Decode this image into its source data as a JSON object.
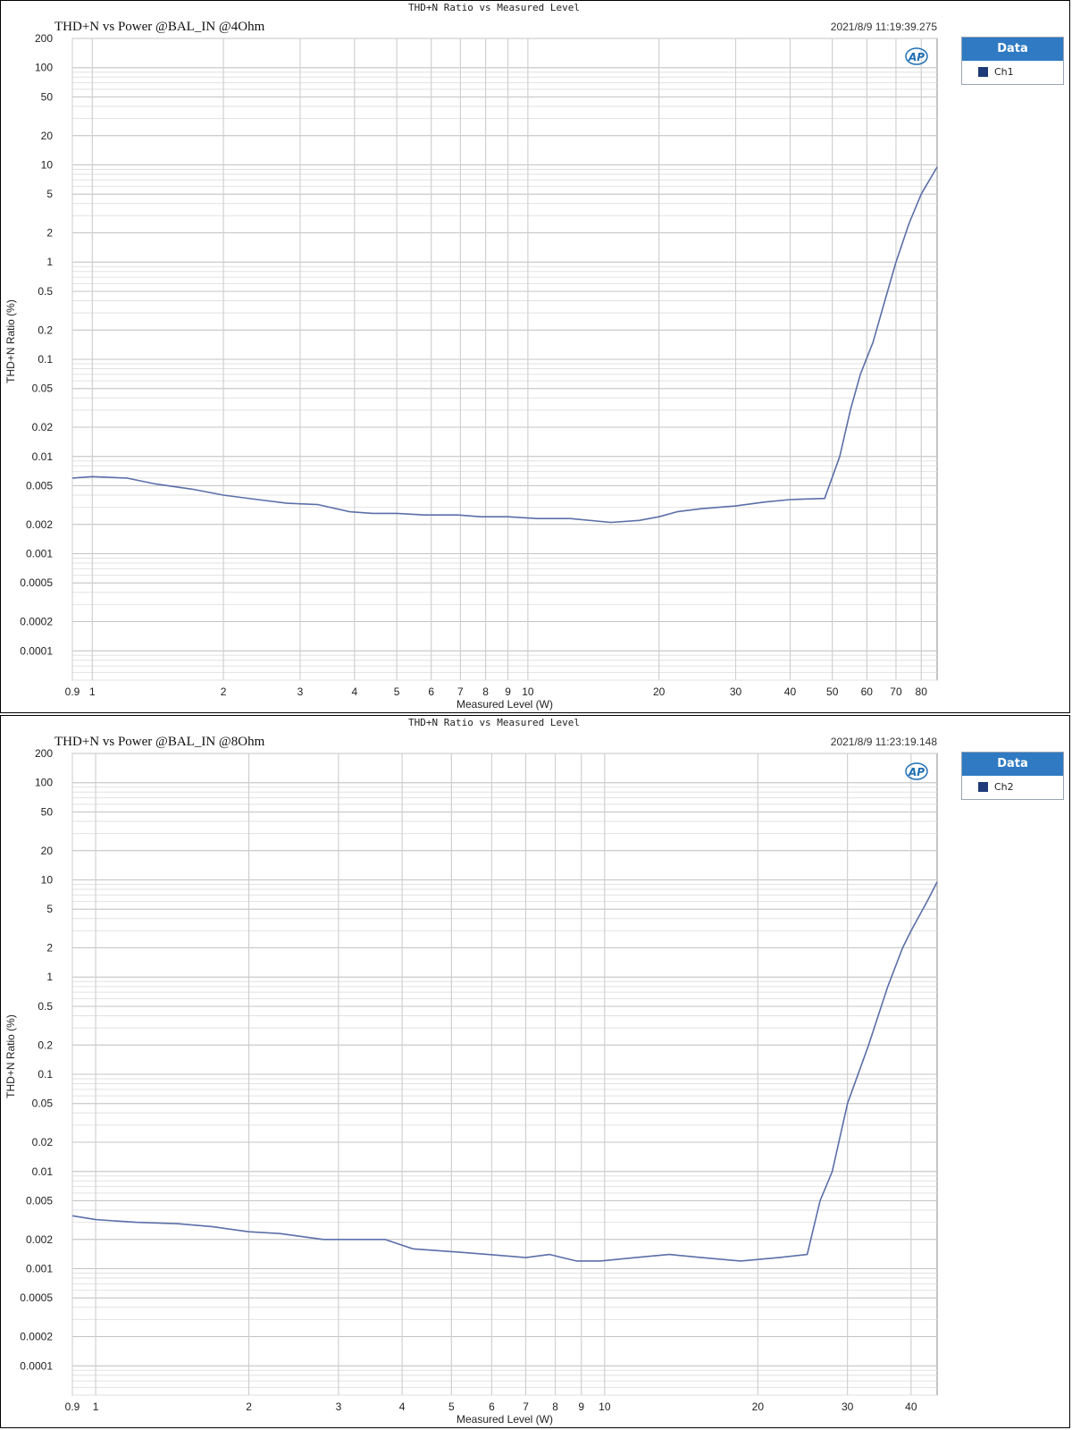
{
  "colors": {
    "line": "#5b6fa8",
    "legend_header": "#2f7ac2",
    "swatch": "#1f3a78",
    "logo": "#1f6fb5"
  },
  "chart_data": [
    {
      "type": "line",
      "suptitle": "THD+N Ratio vs Measured Level",
      "title": "THD+N vs Power @BAL_IN @4Ohm",
      "timestamp": "2021/8/9 11:19:39.275",
      "xlabel": "Measured Level (W)",
      "ylabel": "THD+N Ratio (%)",
      "xscale": "log",
      "yscale": "log",
      "xlim": [
        0.9,
        87
      ],
      "ylim": [
        5e-05,
        200
      ],
      "grid": true,
      "legend_position": "right",
      "legend_title": "Data",
      "x_ticks": [
        0.9,
        1,
        2,
        3,
        4,
        5,
        6,
        7,
        8,
        9,
        10,
        20,
        30,
        40,
        50,
        60,
        70,
        80
      ],
      "x_tick_labels": [
        "0.9",
        "1",
        "2",
        "3",
        "4",
        "5",
        "6",
        "7",
        "8",
        "9",
        "10",
        "20",
        "30",
        "40",
        "50",
        "60",
        "70",
        "80"
      ],
      "y_ticks": [
        200,
        100,
        50,
        20,
        10,
        5,
        2,
        1,
        0.5,
        0.2,
        0.1,
        0.05,
        0.02,
        0.01,
        0.005,
        0.002,
        0.001,
        0.0005,
        0.0002,
        0.0001
      ],
      "y_tick_labels": [
        "200",
        "100",
        "50",
        "20",
        "10",
        "5",
        "2",
        "1",
        "0.5",
        "0.2",
        "0.1",
        "0.05",
        "0.02",
        "0.01",
        "0.005",
        "0.002",
        "0.001",
        "0.0005",
        "0.0002",
        "0.0001"
      ],
      "series": [
        {
          "name": "Ch1",
          "x": [
            0.9,
            1.0,
            1.2,
            1.4,
            1.7,
            2.0,
            2.4,
            2.8,
            3.3,
            3.9,
            4.4,
            5.0,
            5.8,
            6.9,
            7.8,
            9.0,
            10.5,
            12.5,
            15.5,
            18,
            20,
            22,
            25,
            30,
            35,
            40,
            48,
            52,
            55,
            58,
            62,
            66,
            70,
            75,
            80,
            87
          ],
          "y": [
            0.006,
            0.0062,
            0.006,
            0.0052,
            0.0046,
            0.004,
            0.0036,
            0.0033,
            0.0032,
            0.0027,
            0.0026,
            0.0026,
            0.0025,
            0.0025,
            0.0024,
            0.0024,
            0.0023,
            0.0023,
            0.0021,
            0.0022,
            0.0024,
            0.0027,
            0.0029,
            0.0031,
            0.0034,
            0.0036,
            0.0037,
            0.01,
            0.03,
            0.07,
            0.15,
            0.4,
            1.0,
            2.5,
            5.0,
            9.5
          ]
        }
      ]
    },
    {
      "type": "line",
      "suptitle": "THD+N Ratio vs Measured Level",
      "title": "THD+N vs Power @BAL_IN @8Ohm",
      "timestamp": "2021/8/9 11:23:19.148",
      "xlabel": "Measured Level (W)",
      "ylabel": "THD+N Ratio (%)",
      "xscale": "log",
      "yscale": "log",
      "xlim": [
        0.9,
        45
      ],
      "ylim": [
        5e-05,
        200
      ],
      "grid": true,
      "legend_position": "right",
      "legend_title": "Data",
      "x_ticks": [
        0.9,
        1,
        2,
        3,
        4,
        5,
        6,
        7,
        8,
        9,
        10,
        20,
        30,
        40
      ],
      "x_tick_labels": [
        "0.9",
        "1",
        "2",
        "3",
        "4",
        "5",
        "6",
        "7",
        "8",
        "9",
        "10",
        "20",
        "30",
        "40"
      ],
      "y_ticks": [
        200,
        100,
        50,
        20,
        10,
        5,
        2,
        1,
        0.5,
        0.2,
        0.1,
        0.05,
        0.02,
        0.01,
        0.005,
        0.002,
        0.001,
        0.0005,
        0.0002,
        0.0001
      ],
      "y_tick_labels": [
        "200",
        "100",
        "50",
        "20",
        "10",
        "5",
        "2",
        "1",
        "0.5",
        "0.2",
        "0.1",
        "0.05",
        "0.02",
        "0.01",
        "0.005",
        "0.002",
        "0.001",
        "0.0005",
        "0.0002",
        "0.0001"
      ],
      "series": [
        {
          "name": "Ch2",
          "x": [
            0.9,
            1.0,
            1.2,
            1.45,
            1.7,
            2.0,
            2.3,
            2.8,
            3.2,
            3.7,
            4.2,
            5.0,
            5.9,
            7.0,
            7.8,
            8.8,
            9.8,
            11.5,
            13.4,
            15.5,
            18.5,
            22,
            25,
            26.5,
            28,
            30,
            33,
            36,
            38.5,
            40,
            43,
            45
          ],
          "y": [
            0.0035,
            0.0032,
            0.003,
            0.0029,
            0.0027,
            0.0024,
            0.0023,
            0.002,
            0.002,
            0.002,
            0.0016,
            0.0015,
            0.0014,
            0.0013,
            0.0014,
            0.0012,
            0.0012,
            0.0013,
            0.0014,
            0.0013,
            0.0012,
            0.0013,
            0.0014,
            0.005,
            0.01,
            0.05,
            0.2,
            0.8,
            2.0,
            3.0,
            6.0,
            9.5
          ]
        }
      ]
    }
  ]
}
